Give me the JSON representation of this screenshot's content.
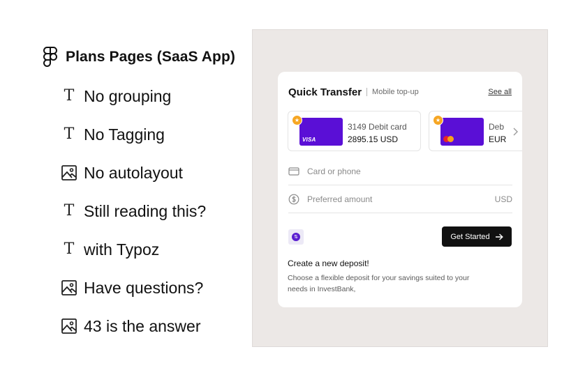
{
  "layers": {
    "file_title": "Plans Pages (SaaS App)",
    "items": [
      {
        "icon": "text-layer-icon",
        "label": "No grouping"
      },
      {
        "icon": "text-layer-icon",
        "label": "No Tagging"
      },
      {
        "icon": "image-layer-icon",
        "label": "No autolayout"
      },
      {
        "icon": "text-layer-icon",
        "label": "Still reading this?"
      },
      {
        "icon": "text-layer-icon",
        "label": "with Typoz"
      },
      {
        "icon": "image-layer-icon",
        "label": "Have questions?"
      },
      {
        "icon": "image-layer-icon",
        "label": "43 is the answer"
      }
    ],
    "text_glyph": "T"
  },
  "card": {
    "title": "Quick Transfer",
    "subtitle": "Mobile top-up",
    "see_all": "See all",
    "payment_cards": [
      {
        "brand": "VISA",
        "name": "3149 Debit card",
        "amount": "2895.15 USD",
        "color": "#5a0fd6"
      },
      {
        "brand": "mastercard",
        "name": "Deb",
        "amount": "EUR",
        "color": "#5a0fd6"
      }
    ],
    "favorite_glyph": "★",
    "card_phone_placeholder": "Card or phone",
    "amount_placeholder": "Preferred amount",
    "amount_currency": "USD",
    "swap_glyph": "⇅",
    "cta_label": "Get Started",
    "deposit_title": "Create a new deposit!",
    "deposit_description": "Choose a flexible deposit for your savings suited to your  needs in InvestBank,"
  },
  "colors": {
    "accent_purple": "#5a0fd6",
    "badge_orange": "#f6a623",
    "canvas_bg": "#ece8e6",
    "cta_bg": "#111111"
  }
}
